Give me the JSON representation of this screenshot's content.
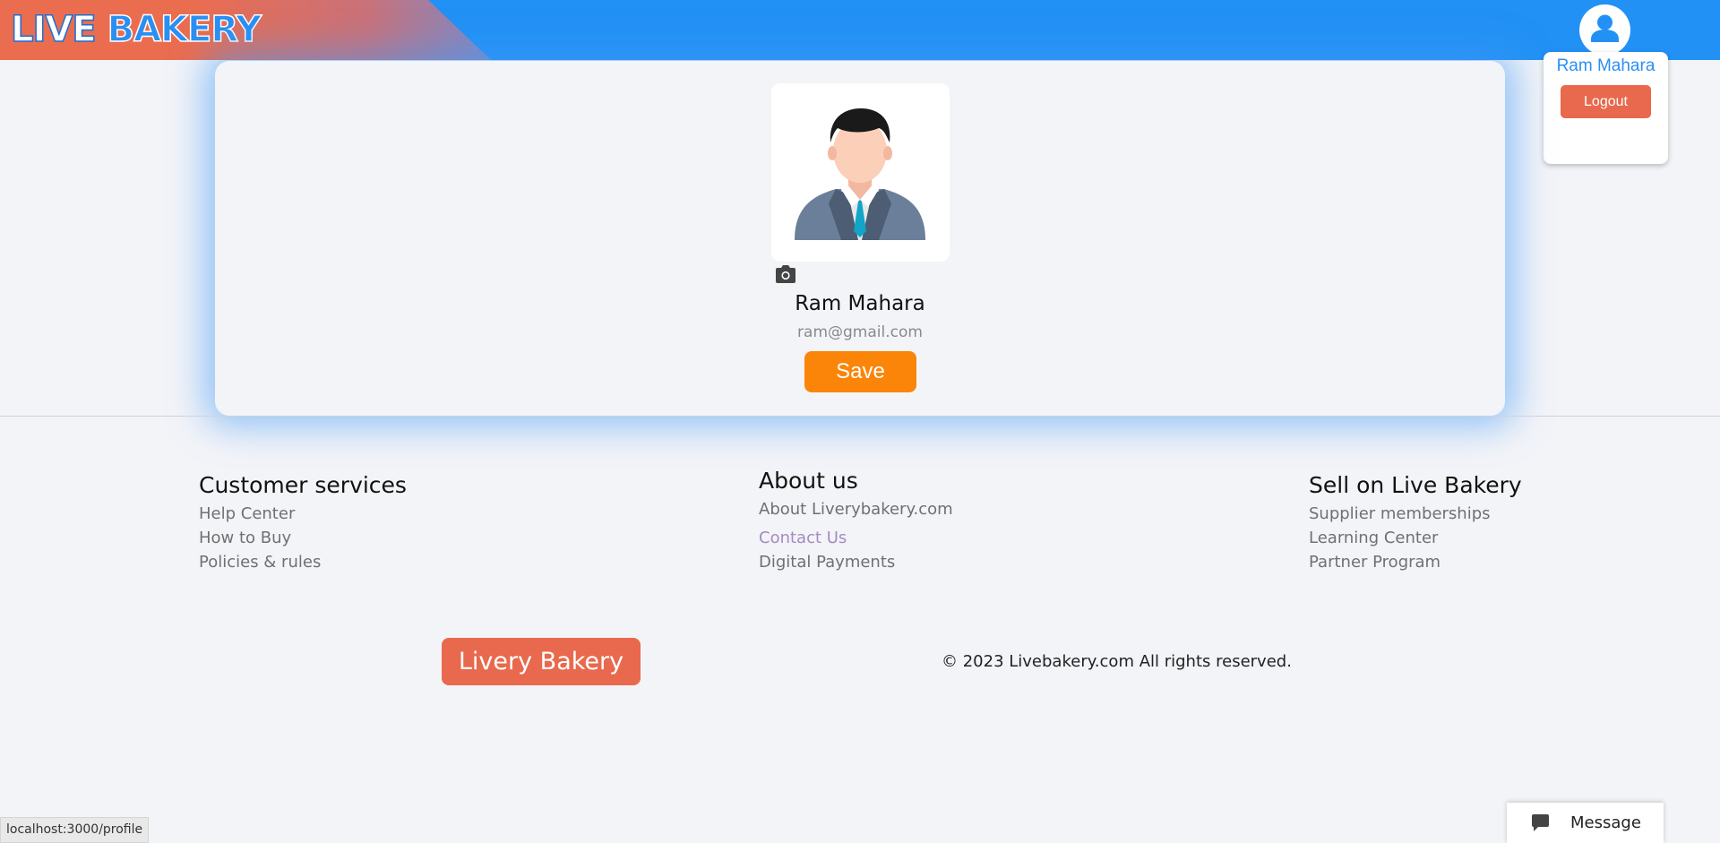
{
  "header": {
    "brand_part1": "LIVE",
    "brand_part2": "BAKERY",
    "user_icon": "user-circle-icon",
    "accent_color": "#2291f5",
    "brand_color": "#ea6d50"
  },
  "user_menu": {
    "name": "Ram Mahara",
    "logout_label": "Logout"
  },
  "profile": {
    "avatar_icon": "businessman-avatar-icon",
    "camera_icon": "camera-icon",
    "name": "Ram Mahara",
    "email": "ram@gmail.com",
    "save_label": "Save",
    "save_color": "#fb8508"
  },
  "footer": {
    "columns": [
      {
        "title": "Customer services",
        "links": [
          "Help Center",
          "How to Buy",
          "Policies & rules"
        ]
      },
      {
        "title": "About us",
        "links": [
          "About Liverybakery.com",
          "Contact Us",
          "Digital Payments"
        ]
      },
      {
        "title": "Sell on Live Bakery",
        "links": [
          "Supplier memberships",
          "Learning Center",
          "Partner Program"
        ]
      }
    ],
    "logo_label": "Livery Bakery",
    "copyright": "© 2023 Livebakery.com All rights reserved."
  },
  "status_bar": {
    "url": "localhost:3000/profile"
  },
  "chat": {
    "label": "Message",
    "icon": "chat-bubble-icon"
  }
}
